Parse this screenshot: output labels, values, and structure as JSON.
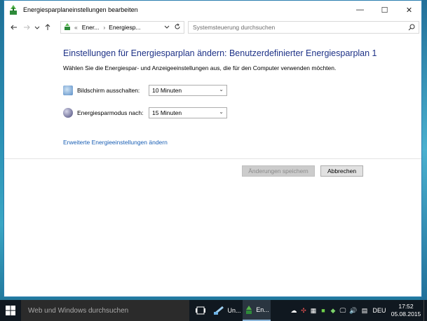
{
  "window": {
    "title": "Energiesparplaneinstellungen bearbeiten",
    "controls": {
      "minimize": "—",
      "maximize": "☐",
      "close": "✕"
    }
  },
  "address": {
    "chevrons": "«",
    "crumb1": "Ener...",
    "crumb2": "Energiesp...",
    "search_placeholder": "Systemsteuerung durchsuchen"
  },
  "main": {
    "heading": "Einstellungen für Energiesparplan ändern: Benutzerdefinierter Energiesparplan 1",
    "subheading": "Wählen Sie die Energiespar- und Anzeigeeinstellungen aus, die für den Computer verwenden möchten.",
    "settings": [
      {
        "label": "Bildschirm ausschalten:",
        "value": "10 Minuten",
        "icon": "monitor-icon"
      },
      {
        "label": "Energiesparmodus nach:",
        "value": "15 Minuten",
        "icon": "moon-icon"
      }
    ],
    "advanced_link": "Erweiterte Energieeinstellungen ändern",
    "save_button": "Änderungen speichern",
    "cancel_button": "Abbrechen"
  },
  "taskbar": {
    "search_placeholder": "Web und Windows durchsuchen",
    "app1_label": "Un...",
    "app2_label": "En...",
    "language": "DEU",
    "time": "17:52",
    "date": "05.08.2015"
  },
  "colors": {
    "heading": "#1e3287",
    "link": "#1a5fb4",
    "taskbar": "#101820"
  }
}
